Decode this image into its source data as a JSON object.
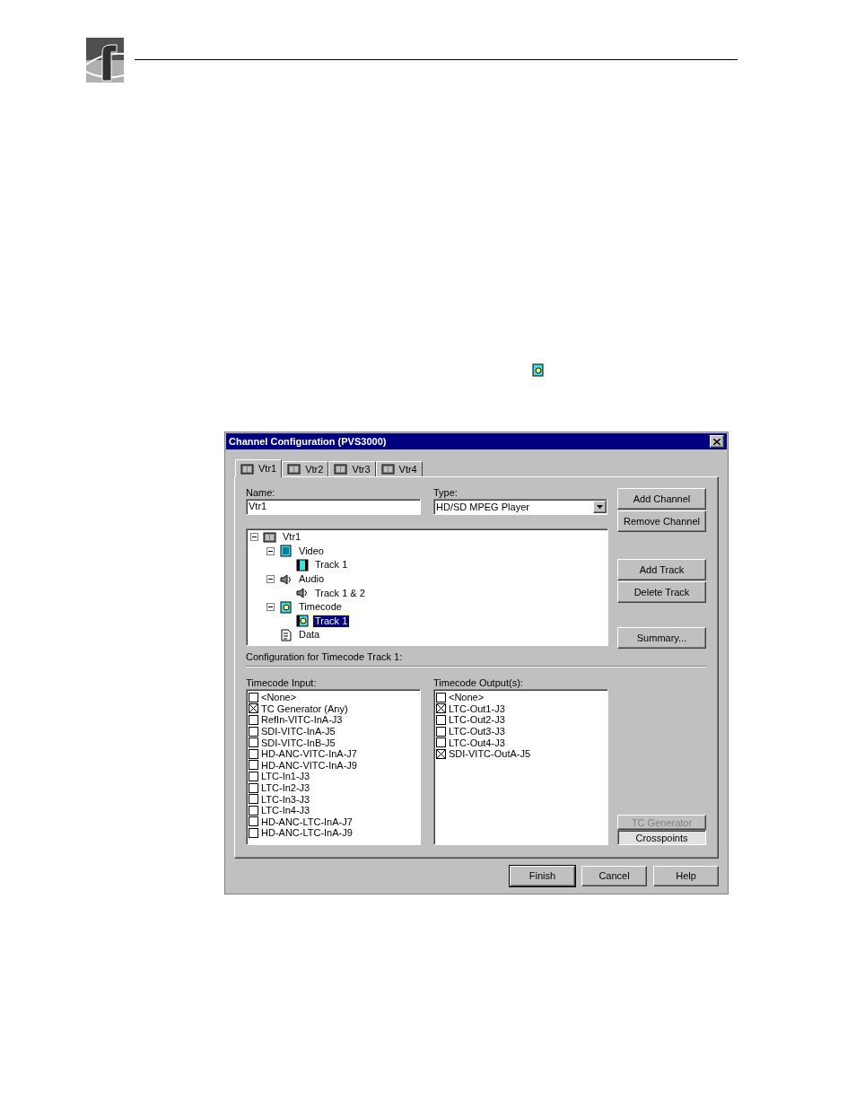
{
  "dialog": {
    "title": "Channel Configuration (PVS3000)",
    "tabs": [
      {
        "label": "Vtr1",
        "selected": true
      },
      {
        "label": "Vtr2",
        "selected": false
      },
      {
        "label": "Vtr3",
        "selected": false
      },
      {
        "label": "Vtr4",
        "selected": false
      }
    ],
    "name": {
      "label": "Name:",
      "value": "Vtr1"
    },
    "type": {
      "label": "Type:",
      "value": "HD/SD MPEG Player"
    },
    "tree": [
      {
        "label": "Vtr1",
        "kind": "vtr",
        "expanded": true,
        "selected": false,
        "children": [
          {
            "label": "Video",
            "kind": "video",
            "expanded": true,
            "selected": false,
            "children": [
              {
                "label": "Track 1",
                "kind": "film",
                "selected": false
              }
            ]
          },
          {
            "label": "Audio",
            "kind": "audio",
            "expanded": true,
            "selected": false,
            "children": [
              {
                "label": "Track 1 & 2",
                "kind": "audio",
                "selected": false
              }
            ]
          },
          {
            "label": "Timecode",
            "kind": "timecode",
            "expanded": true,
            "selected": false,
            "children": [
              {
                "label": "Track 1",
                "kind": "timecode-track",
                "selected": true
              }
            ]
          },
          {
            "label": "Data",
            "kind": "data",
            "selected": false
          }
        ]
      }
    ],
    "config_label": "Configuration for Timecode Track 1:",
    "timecode_input": {
      "label": "Timecode Input:",
      "items": [
        {
          "label": "<None>",
          "checked": false
        },
        {
          "label": "TC Generator (Any)",
          "checked": true
        },
        {
          "label": "RefIn-VITC-InA-J3",
          "checked": false
        },
        {
          "label": "SDI-VITC-InA-J5",
          "checked": false
        },
        {
          "label": "SDI-VITC-InB-J5",
          "checked": false
        },
        {
          "label": "HD-ANC-VITC-InA-J7",
          "checked": false
        },
        {
          "label": "HD-ANC-VITC-InA-J9",
          "checked": false
        },
        {
          "label": "LTC-In1-J3",
          "checked": false
        },
        {
          "label": "LTC-In2-J3",
          "checked": false
        },
        {
          "label": "LTC-In3-J3",
          "checked": false
        },
        {
          "label": "LTC-In4-J3",
          "checked": false
        },
        {
          "label": "HD-ANC-LTC-InA-J7",
          "checked": false
        },
        {
          "label": "HD-ANC-LTC-InA-J9",
          "checked": false
        }
      ]
    },
    "timecode_output": {
      "label": "Timecode Output(s):",
      "items": [
        {
          "label": "<None>",
          "checked": false
        },
        {
          "label": "LTC-Out1-J3",
          "checked": true
        },
        {
          "label": "LTC-Out2-J3",
          "checked": false
        },
        {
          "label": "LTC-Out3-J3",
          "checked": false
        },
        {
          "label": "LTC-Out4-J3",
          "checked": false
        },
        {
          "label": "SDI-VITC-OutA-J5",
          "checked": true
        }
      ]
    },
    "side_buttons": [
      {
        "label": "Add Channel"
      },
      {
        "label": "Remove Channel"
      },
      {
        "label": "Add Track"
      },
      {
        "label": "Delete Track"
      },
      {
        "label": "Summary..."
      }
    ],
    "mode_buttons": [
      {
        "label": "TC Generator",
        "disabled": true,
        "pressed": false
      },
      {
        "label": "Crosspoints",
        "disabled": false,
        "pressed": true
      }
    ],
    "footer_buttons": [
      {
        "label": "Finish",
        "default": true
      },
      {
        "label": "Cancel",
        "default": false
      },
      {
        "label": "Help",
        "default": false
      }
    ]
  }
}
